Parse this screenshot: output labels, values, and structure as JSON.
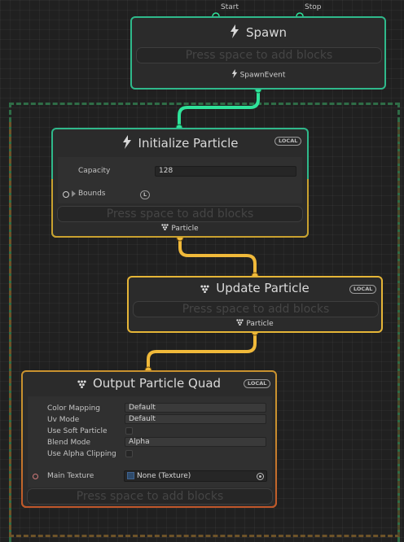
{
  "colors": {
    "spawn_border": "#2fb98b",
    "flow_wire": "#f0b93a",
    "spawn_wire": "#2fe39a",
    "system_green": "#2f6d47",
    "system_orange": "#7b5a2a"
  },
  "spawn": {
    "port_start": "Start",
    "port_stop": "Stop",
    "title": "Spawn",
    "icon": "lightning-icon",
    "placeholder": "Press space to add blocks",
    "output_label": "SpawnEvent"
  },
  "initialize": {
    "title": "Initialize Particle",
    "icon": "lightning-icon",
    "badge": "LOCAL",
    "capacity_label": "Capacity",
    "capacity_value": "128",
    "bounds_label": "Bounds",
    "bounds_space_badge": "L",
    "placeholder": "Press space to add blocks",
    "output_label": "Particle"
  },
  "update": {
    "title": "Update Particle",
    "icon": "particle-dots-icon",
    "badge": "LOCAL",
    "placeholder": "Press space to add blocks",
    "output_label": "Particle"
  },
  "output": {
    "title": "Output Particle Quad",
    "icon": "particle-dots-icon",
    "badge": "LOCAL",
    "rows": {
      "color_mapping_label": "Color Mapping",
      "color_mapping_value": "Default",
      "uv_mode_label": "Uv Mode",
      "uv_mode_value": "Default",
      "soft_particle_label": "Use Soft Particle",
      "blend_mode_label": "Blend Mode",
      "blend_mode_value": "Alpha",
      "alpha_clipping_label": "Use Alpha Clipping",
      "main_texture_label": "Main Texture",
      "main_texture_value": "None (Texture)"
    },
    "placeholder": "Press space to add blocks"
  }
}
